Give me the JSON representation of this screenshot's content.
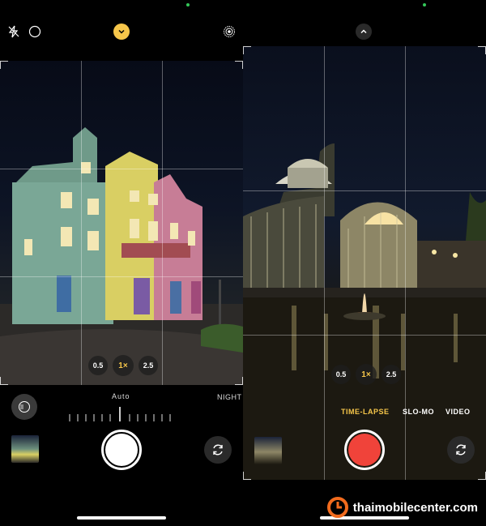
{
  "left_screen": {
    "top_icons": [
      "flash-off-icon",
      "night-mode-icon",
      "chevron-down-icon",
      "live-photo-icon"
    ],
    "zoom_options": [
      "0.5",
      "1×",
      "2.5"
    ],
    "zoom_selected": "1×",
    "exposure_label": "Auto",
    "mode_right_label": "NIGHT",
    "night_mode_control": "night-mode-toggle"
  },
  "right_screen": {
    "top_icons": [
      "chevron-up-icon"
    ],
    "zoom_options": [
      "0.5",
      "1×",
      "2.5"
    ],
    "zoom_selected": "1×",
    "modes": [
      "TIME-LAPSE",
      "SLO-MO",
      "VIDEO"
    ],
    "mode_selected": "TIME-LAPSE"
  },
  "colors": {
    "accent_yellow": "#f6c64a",
    "record_red": "#f0433a",
    "status_green": "#34c759"
  },
  "watermark": {
    "text": "thaimobilecenter.com"
  }
}
